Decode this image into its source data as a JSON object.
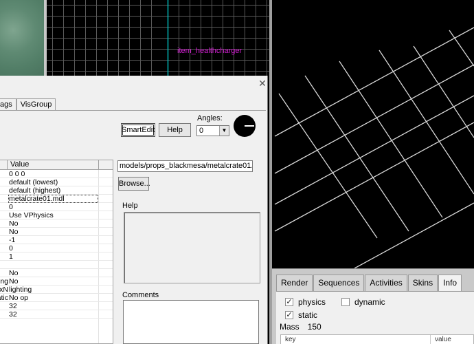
{
  "viewport_2d": {
    "entity_label": "item_healthcharger"
  },
  "dialog": {
    "tabs": [
      {
        "label": "ags",
        "active": false
      },
      {
        "label": "VisGroup",
        "active": false
      }
    ],
    "smartedit_label": "SmartEdit",
    "help_button_label": "Help",
    "angles_label": "Angles:",
    "angles_value": "0",
    "grid": {
      "value_header": "Value",
      "rows": [
        {
          "key": "",
          "value": "0 0 0"
        },
        {
          "key": "",
          "value": "default (lowest)"
        },
        {
          "key": "",
          "value": "default (highest)"
        },
        {
          "key": "",
          "value": "metalcrate01.mdl",
          "selected": true
        },
        {
          "key": "",
          "value": "0"
        },
        {
          "key": "",
          "value": "Use VPhysics"
        },
        {
          "key": "",
          "value": "No"
        },
        {
          "key": "",
          "value": "No"
        },
        {
          "key": "",
          "value": "-1"
        },
        {
          "key": "",
          "value": "0"
        },
        {
          "key": "",
          "value": "1"
        },
        {
          "key": "",
          "value": ""
        },
        {
          "key": "",
          "value": "No"
        },
        {
          "key": "king",
          "value": "No"
        },
        {
          "key": "texN",
          "value": "lighting"
        },
        {
          "key": "static",
          "value": "No op"
        },
        {
          "key": "",
          "value": "32"
        },
        {
          "key": "",
          "value": "32"
        }
      ]
    },
    "model_path": "models/props_blackmesa/metalcrate01.mdl",
    "browse_label": "Browse...",
    "help_label": "Help",
    "comments_label": "Comments"
  },
  "model_panel": {
    "tabs": [
      {
        "label": "Render",
        "active": false
      },
      {
        "label": "Sequences",
        "active": false
      },
      {
        "label": "Activities",
        "active": false
      },
      {
        "label": "Skins",
        "active": false
      },
      {
        "label": "Info",
        "active": true
      }
    ],
    "physics_label": "physics",
    "physics_checked": true,
    "dynamic_label": "dynamic",
    "dynamic_checked": false,
    "static_label": "static",
    "static_checked": true,
    "mass_label": "Mass",
    "mass_value": "150",
    "kv_key_header": "key",
    "kv_value_header": "value"
  }
}
